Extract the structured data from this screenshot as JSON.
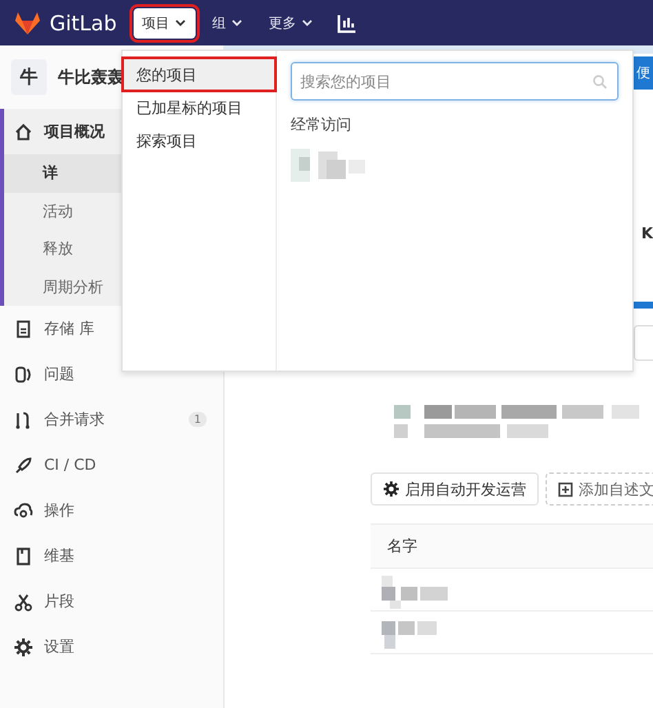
{
  "navbar": {
    "brand": "GitLab",
    "items": [
      {
        "label": "项目",
        "selected": true,
        "highlighted": true
      },
      {
        "label": "组",
        "selected": false,
        "highlighted": false
      },
      {
        "label": "更多",
        "selected": false,
        "highlighted": false
      }
    ]
  },
  "banner": {
    "button": "便"
  },
  "sidebar": {
    "avatar": "牛",
    "project_name": "牛比轰轰",
    "items": [
      {
        "label": "项目概况",
        "selected": true,
        "children": [
          {
            "label": "详",
            "selected": true
          },
          {
            "label": "活动",
            "selected": false
          },
          {
            "label": "释放",
            "selected": false
          },
          {
            "label": "周期分析",
            "selected": false
          }
        ]
      },
      {
        "label": "存储 库",
        "selected": false
      },
      {
        "label": "问题",
        "selected": false
      },
      {
        "label": "合并请求",
        "selected": false,
        "badge": "1"
      },
      {
        "label": "CI / CD",
        "selected": false
      },
      {
        "label": "操作",
        "selected": false
      },
      {
        "label": "维基",
        "selected": false
      },
      {
        "label": "片段",
        "selected": false
      },
      {
        "label": "设置",
        "selected": false
      }
    ]
  },
  "dropdown": {
    "menu": [
      {
        "label": "您的项目",
        "selected": true,
        "highlighted": true
      },
      {
        "label": "已加星标的项目",
        "selected": false,
        "highlighted": false
      },
      {
        "label": "探索项目",
        "selected": false,
        "highlighted": false
      }
    ],
    "search": {
      "placeholder": "搜索您的项目"
    },
    "section_title": "经常访问",
    "frequent": [
      {
        "kind": "picture"
      }
    ]
  },
  "main": {
    "size_text": "K",
    "buttons": [
      {
        "label": "启用自动开发运营",
        "kind": "gear"
      },
      {
        "label": "添加自述文",
        "kind": "dashed"
      }
    ],
    "table": {
      "columns": [
        "名字"
      ],
      "rows": [
        {
          "kind": "picture"
        },
        {
          "kind": "picture"
        }
      ]
    }
  }
}
